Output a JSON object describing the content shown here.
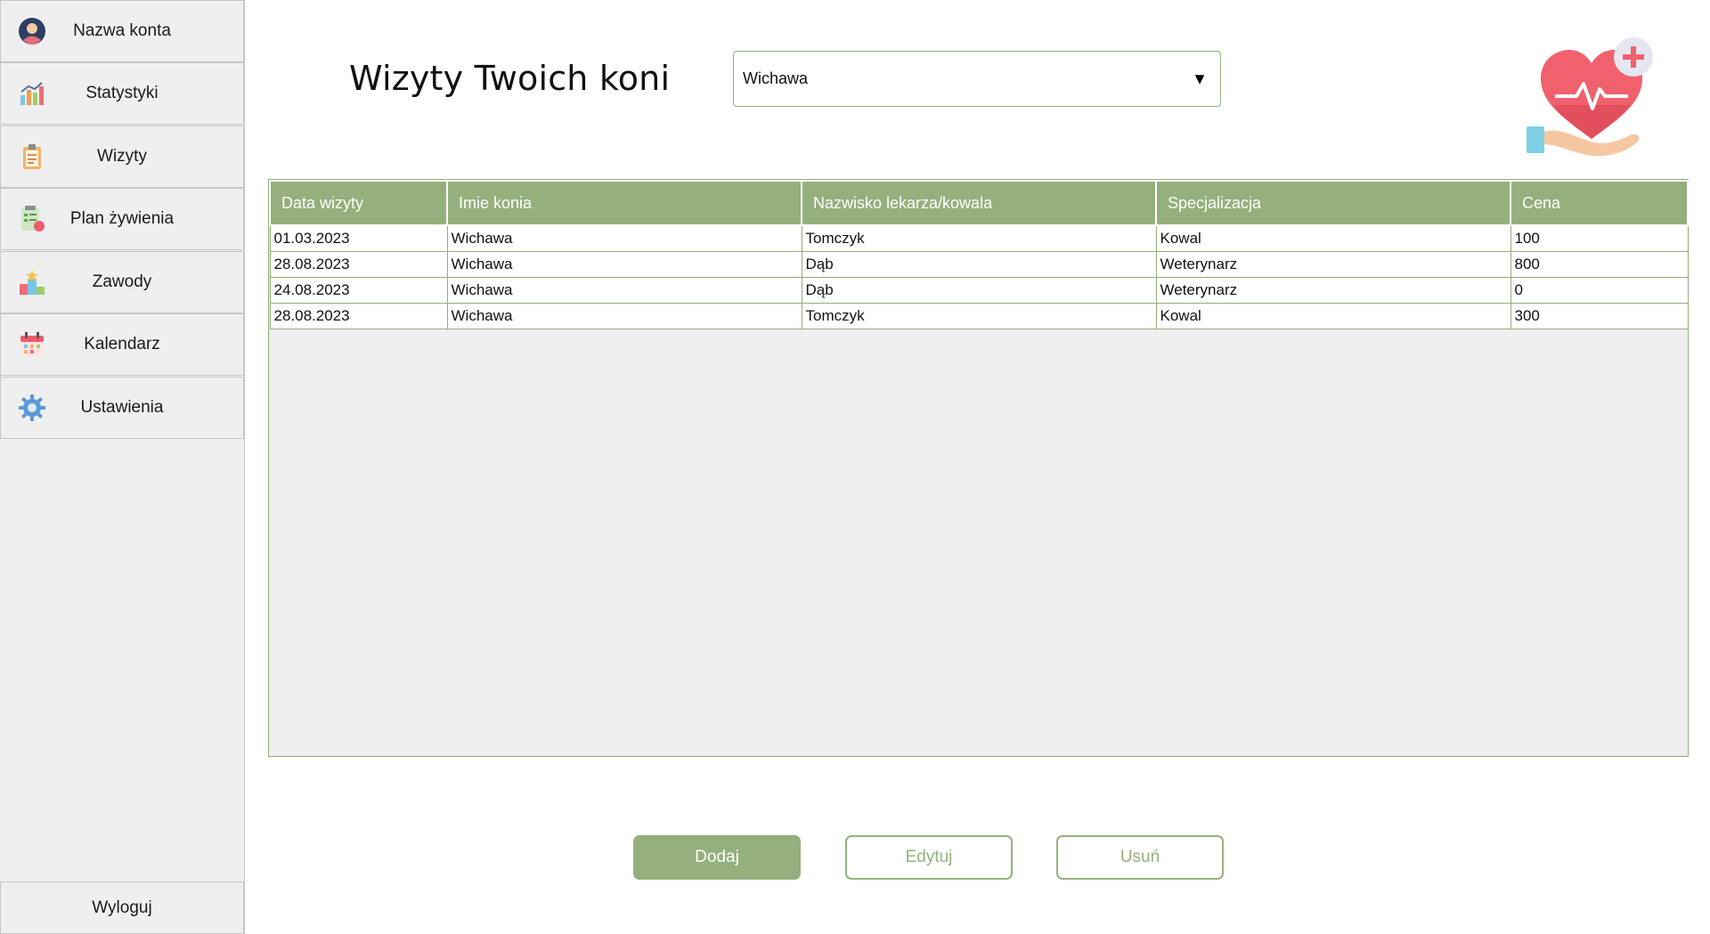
{
  "sidebar": {
    "items": [
      {
        "label": "Nazwa konta",
        "icon": "user-avatar-icon"
      },
      {
        "label": "Statystyki",
        "icon": "bar-chart-icon"
      },
      {
        "label": "Wizyty",
        "icon": "clipboard-icon"
      },
      {
        "label": "Plan żywienia",
        "icon": "meal-plan-icon"
      },
      {
        "label": "Zawody",
        "icon": "podium-icon"
      },
      {
        "label": "Kalendarz",
        "icon": "calendar-icon"
      },
      {
        "label": "Ustawienia",
        "icon": "gear-icon"
      }
    ],
    "logout": "Wyloguj"
  },
  "header": {
    "title": "Wizyty Twoich koni",
    "horse_select": {
      "value": "Wichawa"
    }
  },
  "table": {
    "columns": [
      "Data wizyty",
      "Imie konia",
      "Nazwisko lekarza/kowala",
      "Specjalizacja",
      "Cena"
    ],
    "rows": [
      [
        "01.03.2023",
        "Wichawa",
        "Tomczyk",
        "Kowal",
        "100"
      ],
      [
        "28.08.2023",
        "Wichawa",
        "Dąb",
        "Weterynarz",
        "800"
      ],
      [
        "24.08.2023",
        "Wichawa",
        "Dąb",
        "Weterynarz",
        "0"
      ],
      [
        "28.08.2023",
        "Wichawa",
        "Tomczyk",
        "Kowal",
        "300"
      ]
    ]
  },
  "actions": {
    "add": "Dodaj",
    "edit": "Edytuj",
    "delete": "Usuń"
  },
  "colors": {
    "accent": "#95b07c",
    "sidebar_bg": "#efefef"
  }
}
